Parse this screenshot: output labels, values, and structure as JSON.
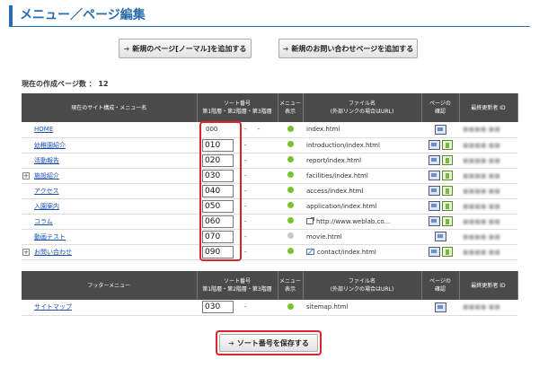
{
  "header": {
    "title": "メニュー／ページ編集"
  },
  "actions": {
    "add_normal_label": "新規のページ[ノーマル]を追加する",
    "add_inquiry_label": "新規のお問い合わせページを追加する",
    "arrow_icon": "arrow-right-icon"
  },
  "page_count_label": "現在の作成ページ数 ： 12",
  "menu_table": {
    "headers": {
      "structure": "現在のサイト構成・メニュー名",
      "sort_line1": "ソート番号",
      "sort_line2": "第1階層・第2階層・第3階層",
      "menu_line1": "メニュー",
      "menu_line2": "表示",
      "file_line1": "ファイル名",
      "file_line2": "(外部リンクの場合はURL)",
      "confirm_line1": "ページの",
      "confirm_line2": "確認",
      "updater": "最終更新者 ID"
    },
    "rows": [
      {
        "name": "HOME",
        "sort": "000",
        "editable": false,
        "dash1": "-",
        "dash2": "-",
        "file": "index.html",
        "file_icon": "",
        "menu_visible": true,
        "mobile": false,
        "expand": false
      },
      {
        "name": "幼稚園紹介",
        "sort": "010",
        "editable": true,
        "dash1": "-",
        "dash2": "",
        "file": "introduction/index.html",
        "file_icon": "",
        "menu_visible": true,
        "mobile": true,
        "expand": false
      },
      {
        "name": "活動報告",
        "sort": "020",
        "editable": true,
        "dash1": "-",
        "dash2": "",
        "file": "report/index.html",
        "file_icon": "",
        "menu_visible": true,
        "mobile": true,
        "expand": false
      },
      {
        "name": "施設紹介",
        "sort": "030",
        "editable": true,
        "dash1": "-",
        "dash2": "",
        "file": "facilities/index.html",
        "file_icon": "",
        "menu_visible": true,
        "mobile": true,
        "expand": true
      },
      {
        "name": "アクセス",
        "sort": "040",
        "editable": true,
        "dash1": "-",
        "dash2": "",
        "file": "access/index.html",
        "file_icon": "",
        "menu_visible": true,
        "mobile": true,
        "expand": false
      },
      {
        "name": "入園案内",
        "sort": "050",
        "editable": true,
        "dash1": "-",
        "dash2": "",
        "file": "application/index.html",
        "file_icon": "",
        "menu_visible": true,
        "mobile": true,
        "expand": false
      },
      {
        "name": "コラム",
        "sort": "060",
        "editable": true,
        "dash1": "-",
        "dash2": "",
        "file": "http://www.weblab.co...",
        "file_icon": "external-link-icon",
        "menu_visible": true,
        "mobile": true,
        "expand": false
      },
      {
        "name": "動画テスト",
        "sort": "070",
        "editable": true,
        "dash1": "-",
        "dash2": "",
        "file": "movie.html",
        "file_icon": "",
        "menu_visible": false,
        "mobile": false,
        "expand": false
      },
      {
        "name": "お問い合わせ",
        "sort": "090",
        "editable": true,
        "dash1": "-",
        "dash2": "",
        "file": "contact/index.html",
        "file_icon": "mail-icon",
        "menu_visible": true,
        "mobile": true,
        "expand": true
      }
    ]
  },
  "footer_table": {
    "headers": {
      "structure": "フッターメニュー",
      "sort_line1": "ソート番号",
      "sort_line2": "第1階層・第2階層・第3階層",
      "menu_line1": "メニュー",
      "menu_line2": "表示",
      "file_line1": "ファイル名",
      "file_line2": "(外部リンクの場合はURL)",
      "confirm_line1": "ページの",
      "confirm_line2": "確認",
      "updater": "最終更新者 ID"
    },
    "rows": [
      {
        "name": "サイトマップ",
        "sort": "030",
        "editable": true,
        "dash1": "-",
        "dash2": "",
        "file": "sitemap.html",
        "file_icon": "",
        "menu_visible": true,
        "mobile": false,
        "expand": false
      }
    ]
  },
  "save_label": "ソート番号を保存する",
  "colors": {
    "accent": "#2b6cb0",
    "highlight": "#d9262c",
    "menu_on": "#7ac12e",
    "menu_off": "#c9c9c9",
    "header_bg": "#4a4a4a"
  }
}
